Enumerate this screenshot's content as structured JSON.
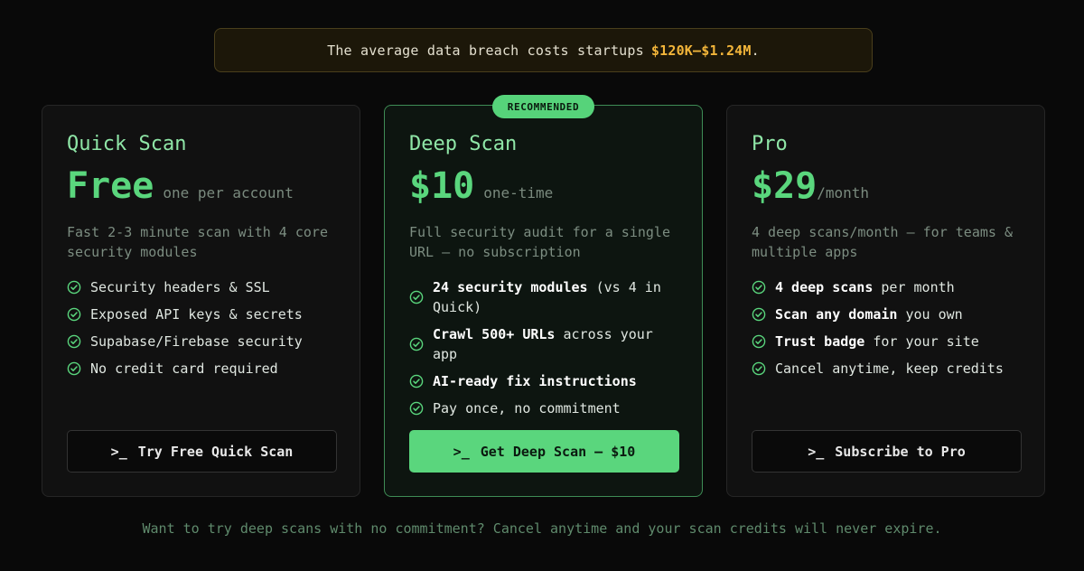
{
  "banner": {
    "prefix": "The average data breach costs startups",
    "highlight": "$120K–$1.24M",
    "suffix": "."
  },
  "badge": "RECOMMENDED",
  "plans": [
    {
      "name": "Quick Scan",
      "price": "Free",
      "price_note": "one per account",
      "description": "Fast 2-3 minute scan with 4 core security modules",
      "features": [
        {
          "bold": "",
          "text": "Security headers & SSL"
        },
        {
          "bold": "",
          "text": "Exposed API keys & secrets"
        },
        {
          "bold": "",
          "text": "Supabase/Firebase security"
        },
        {
          "bold": "",
          "text": "No credit card required"
        }
      ],
      "button_prompt": ">_",
      "button_label": "Try Free Quick Scan"
    },
    {
      "name": "Deep Scan",
      "price": "$10",
      "price_note": "one-time",
      "description": "Full security audit for a single URL — no subscription",
      "features": [
        {
          "bold": "24 security modules",
          "text": " (vs 4 in Quick)"
        },
        {
          "bold": "Crawl 500+ URLs",
          "text": " across your app"
        },
        {
          "bold": "AI-ready fix instructions",
          "text": ""
        },
        {
          "bold": "",
          "text": "Pay once, no commitment"
        }
      ],
      "button_prompt": ">_",
      "button_label": "Get Deep Scan — $10"
    },
    {
      "name": "Pro",
      "price": "$29",
      "price_note": "/month",
      "description": "4 deep scans/month — for teams & multiple apps",
      "features": [
        {
          "bold": "4 deep scans",
          "text": " per month"
        },
        {
          "bold": "Scan any domain",
          "text": " you own"
        },
        {
          "bold": "Trust badge",
          "text": " for your site"
        },
        {
          "bold": "",
          "text": "Cancel anytime, keep credits"
        }
      ],
      "button_prompt": ">_",
      "button_label": "Subscribe to Pro"
    }
  ],
  "footnote": "Want to try deep scans with no commitment? Cancel anytime and your scan credits will never expire.",
  "colors": {
    "accent": "#5ad67d",
    "banner_highlight": "#f2b53a",
    "background": "#090909"
  }
}
